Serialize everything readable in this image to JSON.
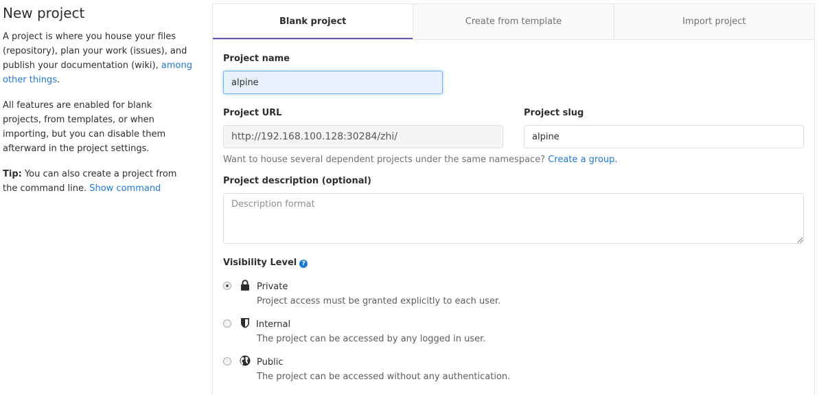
{
  "left": {
    "title": "New project",
    "intro_text": "A project is where you house your files (repository), plan your work (issues), and publish your documentation (wiki),",
    "intro_link": "among other things",
    "intro_end": ".",
    "features_text": "All features are enabled for blank projects, from templates, or when importing, but you can disable them afterward in the project settings.",
    "tip_label": "Tip:",
    "tip_text": "You can also create a project from the command line.",
    "tip_link": "Show command"
  },
  "tabs": [
    {
      "label": "Blank project",
      "active": true
    },
    {
      "label": "Create from template",
      "active": false
    },
    {
      "label": "Import project",
      "active": false
    }
  ],
  "form": {
    "project_name_label": "Project name",
    "project_name_value": "alpine",
    "project_url_label": "Project URL",
    "project_url_value": "http://192.168.100.128:30284/zhi/",
    "project_slug_label": "Project slug",
    "project_slug_value": "alpine",
    "namespace_help": "Want to house several dependent projects under the same namespace?",
    "namespace_link": "Create a group.",
    "description_label": "Project description (optional)",
    "description_placeholder": "Description format",
    "visibility_label": "Visibility Level",
    "visibility_help_icon": "question-circle-icon",
    "visibility_options": [
      {
        "title": "Private",
        "desc": "Project access must be granted explicitly to each user.",
        "icon": "lock-icon",
        "checked": true
      },
      {
        "title": "Internal",
        "desc": "The project can be accessed by any logged in user.",
        "icon": "shield-icon",
        "checked": false
      },
      {
        "title": "Public",
        "desc": "The project can be accessed without any authentication.",
        "icon": "globe-icon",
        "checked": false
      }
    ]
  },
  "colors": {
    "link": "#1f78d1",
    "active_tab_underline": "#6b4fbb",
    "focused_input_bg": "#e8f0fb"
  }
}
